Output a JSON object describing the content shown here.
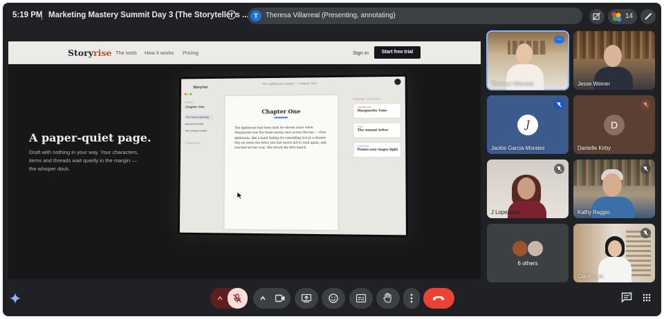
{
  "topbar": {
    "time": "5:19 PM",
    "meeting_title": "Marketing Mastery Summit Day 3 (The Storyteller's ...",
    "presenter_initial": "T",
    "presenter_status": "Theresa Villarreal (Presenting, annotating)",
    "participant_count": "14"
  },
  "shared_screen": {
    "site": {
      "logo_prefix": "Story",
      "logo_suffix": "rise",
      "nav_links": [
        "The tools",
        "How it works",
        "Pricing"
      ],
      "sign_in": "Sign in",
      "cta": "Start free trial"
    },
    "hero": {
      "headline": "A paper-quiet page.",
      "subtext": "Draft with nothing in your way. Your characters, items and threads wait quietly in the margin — the whisper dock."
    },
    "mock_app": {
      "window_title": "The Lighthouse Keeper — Chapter One",
      "brand": "Storyrise",
      "sidebar_label": "DRAFT",
      "sidebar_items": [
        "Chapter One",
        "The Storm Warning",
        "Salt and Smoke",
        "The Unseen Letter",
        "+ New scene"
      ],
      "chapter_title": "Chapter One",
      "body": "The lighthouse had been dark for eleven years when Marguerite saw the beam sweep once across the bay — slow, deliberate, like a hand feeling for something lost in a drawer. She set down the letter she had sworn not to read again, and reached for her coat. She struck the first match.",
      "panel_head": "WHISPER · THIS SCENE",
      "cards": [
        {
          "kind": "CHARACTER",
          "title": "Marguerite Vane",
          "color": "#c0603b"
        },
        {
          "kind": "ITEM",
          "title": "The unsent letter",
          "color": "#b8892d"
        },
        {
          "kind": "LOCATION",
          "title": "Pointe-aux-Anges light",
          "color": "#4c7fbd"
        }
      ]
    }
  },
  "participants": [
    {
      "name": "Theresa Villarreal",
      "kind": "video",
      "active": true
    },
    {
      "name": "Jesse Weiner",
      "kind": "video"
    },
    {
      "name": "Jackie Garcia-Morales",
      "kind": "avatar",
      "avatar": "J",
      "muted": true
    },
    {
      "name": "Danielle Kirby",
      "kind": "avatar",
      "avatar": "D",
      "muted": true
    },
    {
      "name": "J Lopeziano",
      "kind": "video",
      "muted": true
    },
    {
      "name": "Kathy Raggio",
      "kind": "video",
      "muted": true
    },
    {
      "name": "6 others",
      "kind": "group"
    },
    {
      "name": "Claris Lam",
      "kind": "video",
      "muted": true
    }
  ],
  "colors": {
    "background": "#202124",
    "control": "#3c4043",
    "end_call": "#ea4335",
    "mic_off": "#f9dedc",
    "accent": "#8ab4f8"
  },
  "icons": [
    "info-icon",
    "no-camera-icon",
    "people-icon",
    "pen-icon",
    "chevron-up-icon",
    "mic-off-icon",
    "camera-icon",
    "present-icon",
    "emoji-icon",
    "captions-icon",
    "hand-icon",
    "more-icon",
    "end-call-icon",
    "chat-icon",
    "apps-icon",
    "gemini-icon"
  ]
}
